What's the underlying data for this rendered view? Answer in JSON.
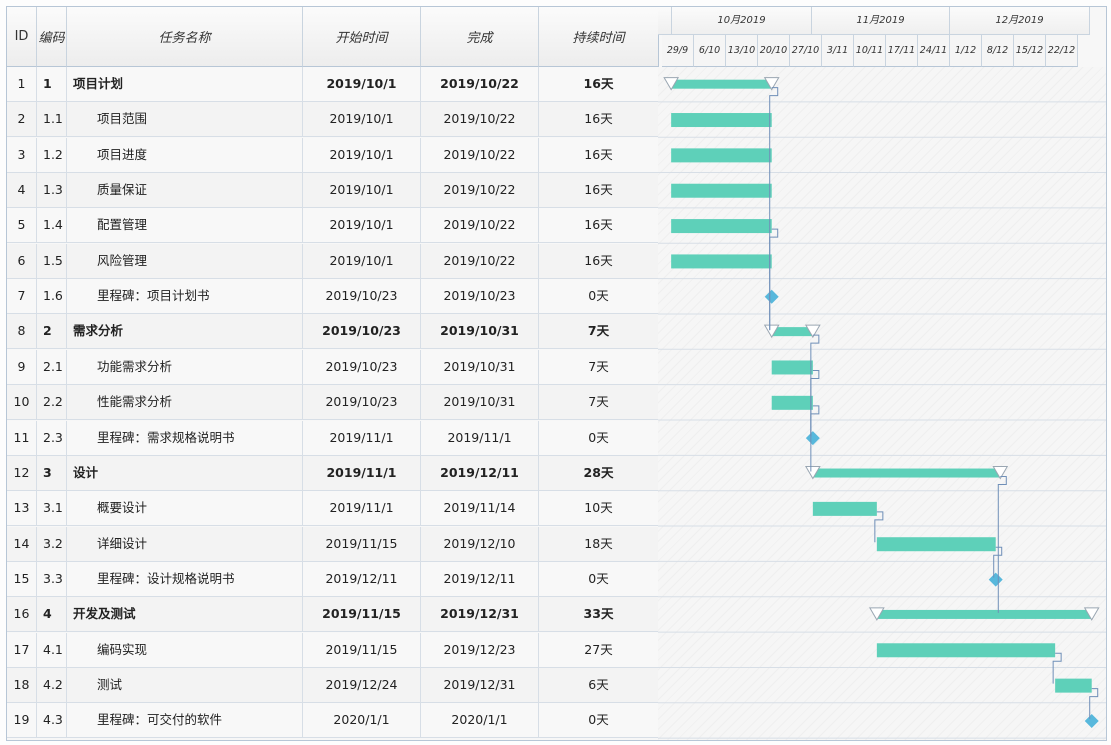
{
  "columns": {
    "id": "ID",
    "code": "编码",
    "name": "任务名称",
    "start": "开始时间",
    "end": "完成",
    "duration": "持续时间"
  },
  "timeline": {
    "months": [
      "10月2019",
      "11月2019",
      "12月2019"
    ],
    "weeks": [
      "29/9",
      "6/10",
      "13/10",
      "20/10",
      "27/10",
      "3/11",
      "10/11",
      "17/11",
      "24/11",
      "1/12",
      "8/12",
      "15/12",
      "22/12"
    ]
  },
  "tasks": [
    {
      "id": "1",
      "code": "1",
      "name": "项目计划",
      "start": "2019/10/1",
      "end": "2019/10/22",
      "duration": "16天",
      "summary": true,
      "milestone": false
    },
    {
      "id": "2",
      "code": "1.1",
      "name": "项目范围",
      "start": "2019/10/1",
      "end": "2019/10/22",
      "duration": "16天",
      "summary": false,
      "milestone": false
    },
    {
      "id": "3",
      "code": "1.2",
      "name": "项目进度",
      "start": "2019/10/1",
      "end": "2019/10/22",
      "duration": "16天",
      "summary": false,
      "milestone": false
    },
    {
      "id": "4",
      "code": "1.3",
      "name": "质量保证",
      "start": "2019/10/1",
      "end": "2019/10/22",
      "duration": "16天",
      "summary": false,
      "milestone": false
    },
    {
      "id": "5",
      "code": "1.4",
      "name": "配置管理",
      "start": "2019/10/1",
      "end": "2019/10/22",
      "duration": "16天",
      "summary": false,
      "milestone": false
    },
    {
      "id": "6",
      "code": "1.5",
      "name": "风险管理",
      "start": "2019/10/1",
      "end": "2019/10/22",
      "duration": "16天",
      "summary": false,
      "milestone": false
    },
    {
      "id": "7",
      "code": "1.6",
      "name": "里程碑：项目计划书",
      "start": "2019/10/23",
      "end": "2019/10/23",
      "duration": "0天",
      "summary": false,
      "milestone": true
    },
    {
      "id": "8",
      "code": "2",
      "name": "需求分析",
      "start": "2019/10/23",
      "end": "2019/10/31",
      "duration": "7天",
      "summary": true,
      "milestone": false
    },
    {
      "id": "9",
      "code": "2.1",
      "name": "功能需求分析",
      "start": "2019/10/23",
      "end": "2019/10/31",
      "duration": "7天",
      "summary": false,
      "milestone": false
    },
    {
      "id": "10",
      "code": "2.2",
      "name": "性能需求分析",
      "start": "2019/10/23",
      "end": "2019/10/31",
      "duration": "7天",
      "summary": false,
      "milestone": false
    },
    {
      "id": "11",
      "code": "2.3",
      "name": "里程碑：需求规格说明书",
      "start": "2019/11/1",
      "end": "2019/11/1",
      "duration": "0天",
      "summary": false,
      "milestone": true
    },
    {
      "id": "12",
      "code": "3",
      "name": "设计",
      "start": "2019/11/1",
      "end": "2019/12/11",
      "duration": "28天",
      "summary": true,
      "milestone": false
    },
    {
      "id": "13",
      "code": "3.1",
      "name": "概要设计",
      "start": "2019/11/1",
      "end": "2019/11/14",
      "duration": "10天",
      "summary": false,
      "milestone": false
    },
    {
      "id": "14",
      "code": "3.2",
      "name": "详细设计",
      "start": "2019/11/15",
      "end": "2019/12/10",
      "duration": "18天",
      "summary": false,
      "milestone": false
    },
    {
      "id": "15",
      "code": "3.3",
      "name": "里程碑：设计规格说明书",
      "start": "2019/12/11",
      "end": "2019/12/11",
      "duration": "0天",
      "summary": false,
      "milestone": true
    },
    {
      "id": "16",
      "code": "4",
      "name": "开发及测试",
      "start": "2019/11/15",
      "end": "2019/12/31",
      "duration": "33天",
      "summary": true,
      "milestone": false
    },
    {
      "id": "17",
      "code": "4.1",
      "name": "编码实现",
      "start": "2019/11/15",
      "end": "2019/12/23",
      "duration": "27天",
      "summary": false,
      "milestone": false
    },
    {
      "id": "18",
      "code": "4.2",
      "name": "测试",
      "start": "2019/12/24",
      "end": "2019/12/31",
      "duration": "6天",
      "summary": false,
      "milestone": false
    },
    {
      "id": "19",
      "code": "4.3",
      "name": "里程碑：可交付的软件",
      "start": "2020/1/1",
      "end": "2020/1/1",
      "duration": "0天",
      "summary": false,
      "milestone": true
    }
  ],
  "colors": {
    "bar": "#5ed0b9",
    "milestone": "#58b8dc",
    "link": "#6f8fb8",
    "summary_marker": "#ffffff"
  }
}
